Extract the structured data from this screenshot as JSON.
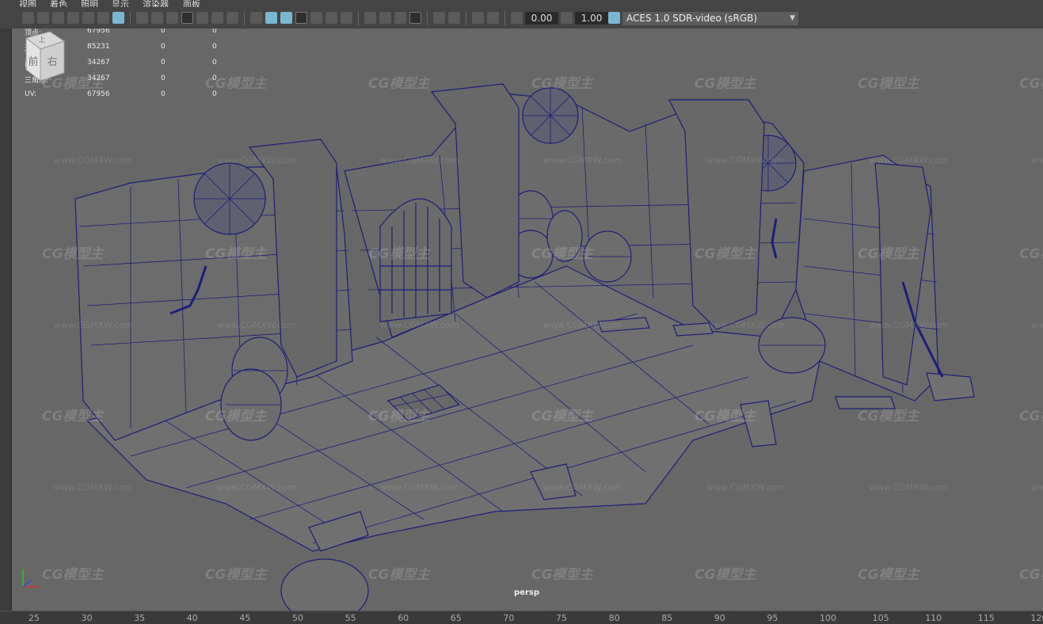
{
  "menu": [
    "视图",
    "着色",
    "照明",
    "显示",
    "渲染器",
    "面板"
  ],
  "toolbar": {
    "exposure_value": "0.00",
    "gamma_value": "1.00",
    "color_space": "ACES 1.0 SDR-video (sRGB)"
  },
  "hud": {
    "rows": [
      {
        "label": "顶点:",
        "values": [
          "67956",
          "0",
          "0"
        ]
      },
      {
        "label": "边:",
        "values": [
          "85231",
          "0",
          "0"
        ]
      },
      {
        "label": "面:",
        "values": [
          "34267",
          "0",
          "0"
        ]
      },
      {
        "label": "三角形:",
        "values": [
          "34267",
          "0",
          "0"
        ]
      },
      {
        "label": "UV:",
        "values": [
          "67956",
          "0",
          "0"
        ]
      }
    ]
  },
  "viewcube": {
    "front": "前",
    "right": "右",
    "top": "上"
  },
  "camera": "persp",
  "timeline": {
    "ticks": [
      "25",
      "30",
      "35",
      "40",
      "45",
      "50",
      "55",
      "60",
      "65",
      "70",
      "75",
      "80",
      "85",
      "90",
      "95",
      "100",
      "105",
      "110",
      "115",
      "120"
    ]
  },
  "watermark": {
    "logo": "CG模型主",
    "url": "www.CGMXW.com"
  },
  "colors": {
    "wire": "#1e1e78",
    "viewport_bg": "#676767",
    "accent": "#7ab6cf"
  },
  "icons": [
    "camera-icon",
    "bookmark-icon",
    "grid-icon",
    "film-gate-icon",
    "isolate-icon",
    "wireframe-icon",
    "smooth-shade-icon",
    "textured-icon",
    "lights-icon",
    "shadows-icon",
    "xray-icon",
    "exposure-icon",
    "gamma-icon",
    "color-management-icon"
  ]
}
